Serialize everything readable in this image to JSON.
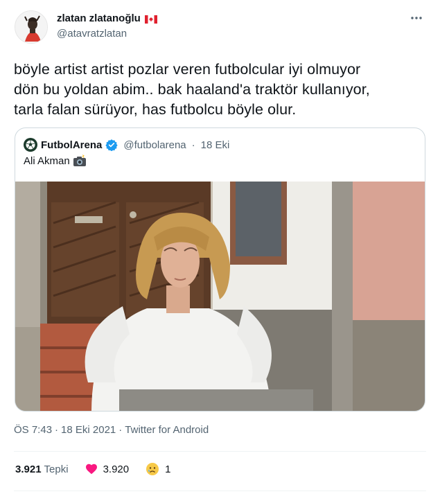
{
  "author": {
    "display_name": "zlatan zlatanoğlu",
    "handle": "@atavratzlatan",
    "flag_icon": "canada-flag-icon"
  },
  "tweet": {
    "lines": [
      "böyle artist artist pozlar veren futbolcular iyi olmuyor",
      "dön bu yoldan abim.. bak haaland'a traktör kullanıyor,",
      "tarla falan sürüyor, has futbolcu böyle olur."
    ]
  },
  "quoted": {
    "display_name": "FutbolArena",
    "handle": "@futbolarena",
    "separator": "·",
    "date": "18 Eki",
    "text": "Ali Akman",
    "text_icon": "camera-flash-icon"
  },
  "meta": {
    "time": "ÖS 7:43",
    "date": "18 Eki 2021",
    "separator": "·",
    "source": "Twitter for Android"
  },
  "stats": {
    "reactions_count": "3.921",
    "reactions_label": "Tepki",
    "likes_count": "3.920",
    "sad_count": "1"
  },
  "colors": {
    "text": "#0f1419",
    "secondary": "#536471",
    "border": "#cfd9de",
    "like": "#f91880",
    "verified": "#1d9bf0"
  }
}
